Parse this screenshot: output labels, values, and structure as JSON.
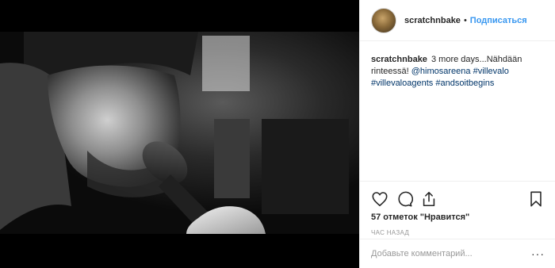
{
  "post": {
    "username": "scratchnbake",
    "separator": "•",
    "follow_label": "Подписаться",
    "caption": {
      "username": "scratchnbake",
      "text": "3 more days...Nähdään rinteessä!",
      "mention": "@himosareena",
      "hashtags": [
        "#villevalo",
        "#villevaloagents",
        "#andsoitbegins"
      ]
    },
    "likes_text": "57 отметок \"Нравится\"",
    "time_text": "час назад",
    "comment_placeholder": "Добавьте комментарий...",
    "more_label": "···"
  },
  "icons": {
    "like": "heart-icon",
    "comment": "comment-icon",
    "share": "share-icon",
    "save": "bookmark-icon",
    "more": "more-options-icon"
  },
  "colors": {
    "link_blue": "#3897f0",
    "hashtag": "#003569",
    "muted": "#999999",
    "text": "#262626"
  }
}
